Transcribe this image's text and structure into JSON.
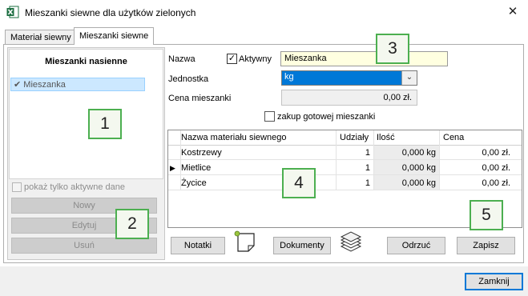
{
  "window": {
    "title": "Mieszanki siewne dla użytków zielonych",
    "close_glyph": "✕",
    "app_icon": "excel-icon"
  },
  "tabs": [
    {
      "label": "Materiał siewny",
      "active": false
    },
    {
      "label": "Mieszanki siewne",
      "active": true
    }
  ],
  "left": {
    "header": "Mieszanki nasienne",
    "items": [
      {
        "label": "Mieszanka",
        "checked": true,
        "selected": true
      }
    ],
    "check_glyph": "✔",
    "only_active_label": "pokaż tylko aktywne dane",
    "buttons": {
      "new": "Nowy",
      "edit": "Edytuj",
      "delete": "Usuń"
    }
  },
  "form": {
    "name_label": "Nazwa",
    "active_label": "Aktywny",
    "active_checked": true,
    "active_glyph": "✓",
    "name_value": "Mieszanka",
    "unit_label": "Jednostka",
    "unit_value": "kg",
    "price_label": "Cena mieszanki",
    "price_value": "0,00 zł.",
    "ready_mix_label": "zakup gotowej mieszanki",
    "ready_mix_checked": false
  },
  "grid": {
    "columns": [
      "Nazwa materiału siewnego",
      "Udziały",
      "Ilość",
      "Cena"
    ],
    "current_row_marker": "▶",
    "rows": [
      {
        "name": "Kostrzewy",
        "share": "1",
        "qty": "0,000 kg",
        "price": "0,00 zł.",
        "current": false
      },
      {
        "name": "Mietlice",
        "share": "1",
        "qty": "0,000 kg",
        "price": "0,00 zł.",
        "current": true
      },
      {
        "name": "Życice",
        "share": "1",
        "qty": "0,000 kg",
        "price": "0,00 zł.",
        "current": false
      }
    ]
  },
  "actions": {
    "notes": "Notatki",
    "documents": "Dokumenty",
    "revert": "Odrzuć",
    "save": "Zapisz",
    "close": "Zamknij",
    "notes_icon": "sticky-note-icon",
    "documents_icon": "stacked-documents-icon"
  },
  "callouts": [
    "1",
    "2",
    "3",
    "4",
    "5"
  ],
  "colors": {
    "selection": "#cce8ff",
    "input_yellow": "#ffffe0",
    "dropdown_selected": "#0078d7",
    "callout_border": "#4caf50"
  }
}
